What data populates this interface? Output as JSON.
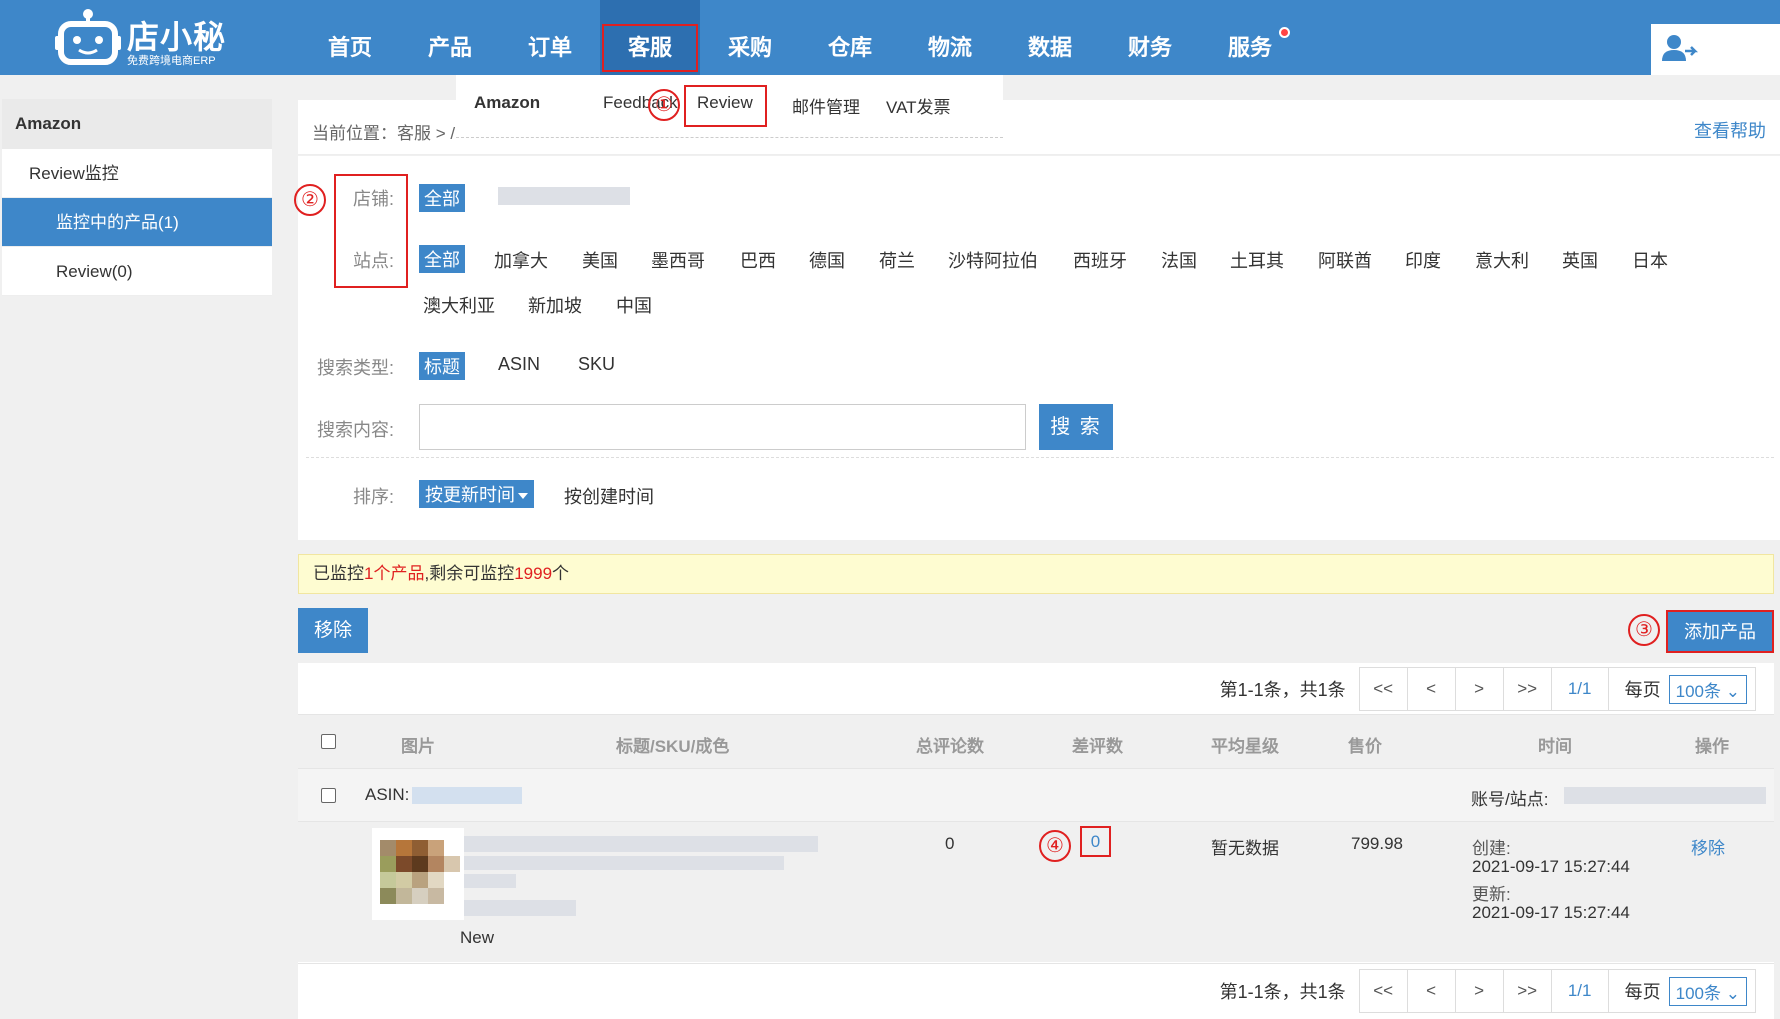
{
  "header": {
    "logo_name": "店小秘",
    "logo_sub": "免费跨境电商ERP",
    "nav": [
      "首页",
      "产品",
      "订单",
      "客服",
      "采购",
      "仓库",
      "物流",
      "数据",
      "财务",
      "服务"
    ]
  },
  "submenu": {
    "head": "Amazon",
    "items": [
      "Feedback",
      "Review",
      "邮件管理",
      "VAT发票"
    ]
  },
  "sidebar": {
    "head": "Amazon",
    "items": [
      {
        "label": "Review监控"
      },
      {
        "label": "监控中的产品(1)"
      },
      {
        "label": "Review(0)"
      }
    ]
  },
  "breadcrumb": {
    "text": "当前位置：客服 > /",
    "help": "查看帮助"
  },
  "filters": {
    "shop_label": "店铺:",
    "shop_all": "全部",
    "site_label": "站点:",
    "site_all": "全部",
    "sites": [
      "加拿大",
      "美国",
      "墨西哥",
      "巴西",
      "德国",
      "荷兰",
      "沙特阿拉伯",
      "西班牙",
      "法国",
      "土耳其",
      "阿联酋",
      "印度",
      "意大利",
      "英国",
      "日本",
      "澳大利亚",
      "新加坡",
      "中国"
    ],
    "search_type_label": "搜索类型:",
    "search_types": [
      "标题",
      "ASIN",
      "SKU"
    ],
    "search_content_label": "搜索内容:",
    "search_value": "",
    "search_button": "搜 索",
    "sort_label": "排序:",
    "sort_selected": "按更新时间",
    "sort_other": "按创建时间"
  },
  "markers": [
    "①",
    "②",
    "③",
    "④"
  ],
  "notice": {
    "p1": "已监控",
    "count": "1个产品",
    "p2": ",剩余可监控",
    "remaining": "1999",
    "p3": "个"
  },
  "actions": {
    "remove": "移除",
    "add": "添加产品"
  },
  "pager": {
    "info": "第1-1条，共1条",
    "first": "<<",
    "prev": "<",
    "next": ">",
    "last": ">>",
    "current": "1/1",
    "size_label": "每页",
    "size": "100条"
  },
  "table": {
    "headers": [
      "图片",
      "标题/SKU/成色",
      "总评论数",
      "差评数",
      "平均星级",
      "售价",
      "时间",
      "操作"
    ],
    "group": {
      "asin_label": "ASIN:",
      "account_label": "账号/站点:"
    },
    "row": {
      "condition": "New",
      "total_reviews": "0",
      "bad_reviews": "0",
      "avg_rating": "暂无数据",
      "price": "799.98",
      "created_label": "创建:",
      "created": "2021-09-17 15:27:44",
      "updated_label": "更新:",
      "updated": "2021-09-17 15:27:44",
      "action": "移除"
    }
  }
}
